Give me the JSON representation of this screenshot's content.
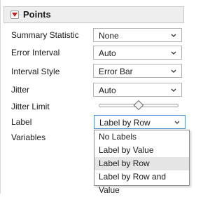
{
  "panel": {
    "title": "Points"
  },
  "rows": {
    "summary_statistic": {
      "label": "Summary Statistic",
      "value": "None"
    },
    "error_interval": {
      "label": "Error Interval",
      "value": "Auto"
    },
    "interval_style": {
      "label": "Interval Style",
      "value": "Error Bar"
    },
    "jitter": {
      "label": "Jitter",
      "value": "Auto"
    },
    "jitter_limit": {
      "label": "Jitter Limit",
      "level": 0.5
    },
    "label": {
      "label": "Label",
      "value": "Label by Row"
    },
    "variables": {
      "label": "Variables"
    }
  },
  "label_dropdown": {
    "options": [
      "No Labels",
      "Label by Value",
      "Label by Row",
      "Label by Row and Value"
    ],
    "selected_index": 2
  },
  "colors": {
    "disclosure_red": "#cc1f1f",
    "focus_border": "#4a90d9",
    "selected_bg": "#e5e5e5"
  }
}
